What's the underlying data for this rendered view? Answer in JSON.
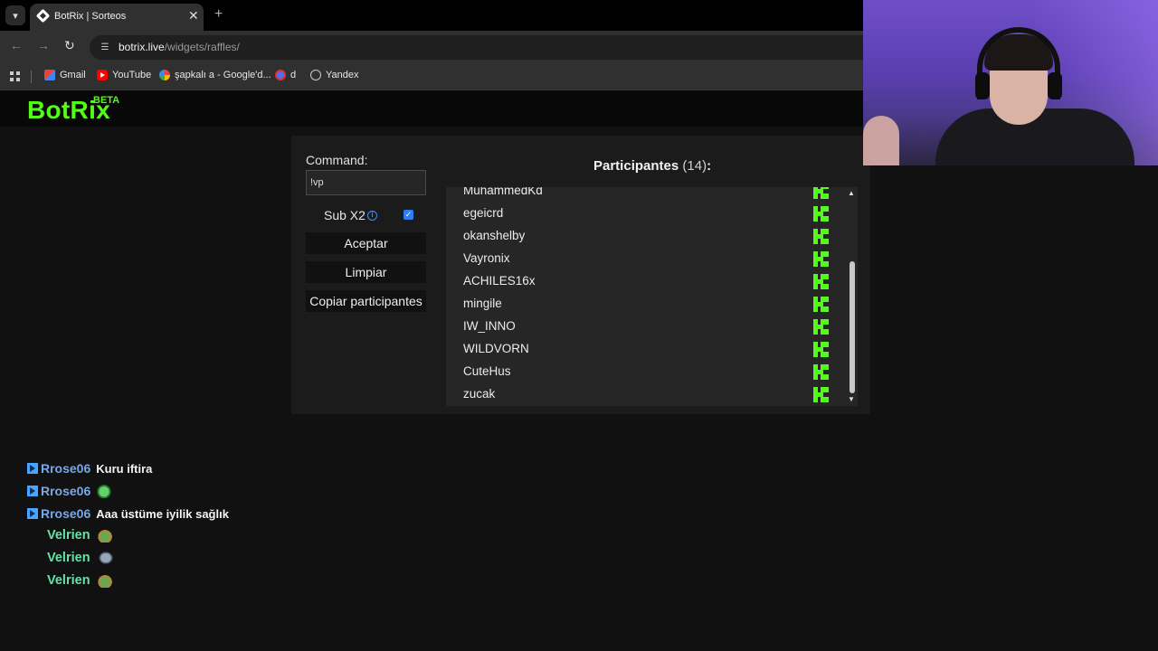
{
  "browser": {
    "tab_title": "BotRix | Sorteos",
    "url_host": "botrix.live",
    "url_path": "/widgets/raffles/",
    "bookmarks": [
      "Gmail",
      "YouTube",
      "şapkalı a - Google'd...",
      "d",
      "Yandex"
    ]
  },
  "site": {
    "logo": "BotRix",
    "beta": "BETA"
  },
  "panel": {
    "command_label": "Command:",
    "command_value": "!vp",
    "sub_label": "Sub X2",
    "sub_checked": true,
    "accept": "Aceptar",
    "clear": "Limpiar",
    "copy": "Copiar participantes",
    "participants_label": "Participantes",
    "participants_count": "(14)",
    "participants_colon": ":",
    "participants": [
      "MuhammedKd",
      "egeicrd",
      "okanshelby",
      "Vayronix",
      "ACHILES16x",
      "mingile",
      "IW_INNO",
      "WILDVORN",
      "CuteHus",
      "zucak"
    ]
  },
  "chat": [
    {
      "user": "Rrose06",
      "text": "Kuru iftira",
      "emote": ""
    },
    {
      "user": "Rrose06",
      "text": "",
      "emote": "green-emote"
    },
    {
      "user": "Rrose06",
      "text": "Aaa üstüme iyilik sağlık",
      "emote": ""
    },
    {
      "user": "Velrien",
      "text": "",
      "emote": "turtle-emote"
    },
    {
      "user": "Velrien",
      "text": "",
      "emote": "bird-emote"
    },
    {
      "user": "Velrien",
      "text": "",
      "emote": "turtle-emote"
    }
  ],
  "colors": {
    "brand": "#53fc18",
    "rose_user": "#7aa8e6",
    "velrien_user": "#67e2a8"
  }
}
